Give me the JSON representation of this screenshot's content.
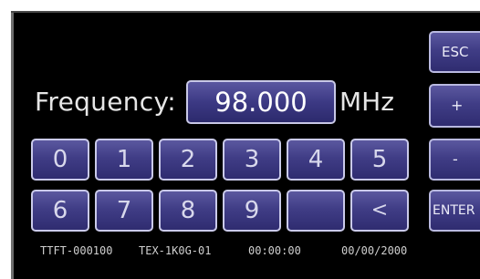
{
  "frequency": {
    "label": "Frequency:",
    "value": "98.000",
    "unit": "MHz"
  },
  "keypad": {
    "row1": [
      "0",
      "1",
      "2",
      "3",
      "4",
      "5"
    ],
    "row2": [
      "6",
      "7",
      "8",
      "9",
      "",
      "<"
    ]
  },
  "side_buttons": {
    "esc": "ESC",
    "plus": "+",
    "minus": "-",
    "enter": "ENTER"
  },
  "status_bar": {
    "device_id": "TTFT-000100",
    "model": "TEX-1K0G-01",
    "time": "00:00:00",
    "date": "00/00/2000"
  },
  "colors": {
    "button_fill": "#3f3c86",
    "button_border": "#cacaea",
    "screen": "#000000"
  }
}
